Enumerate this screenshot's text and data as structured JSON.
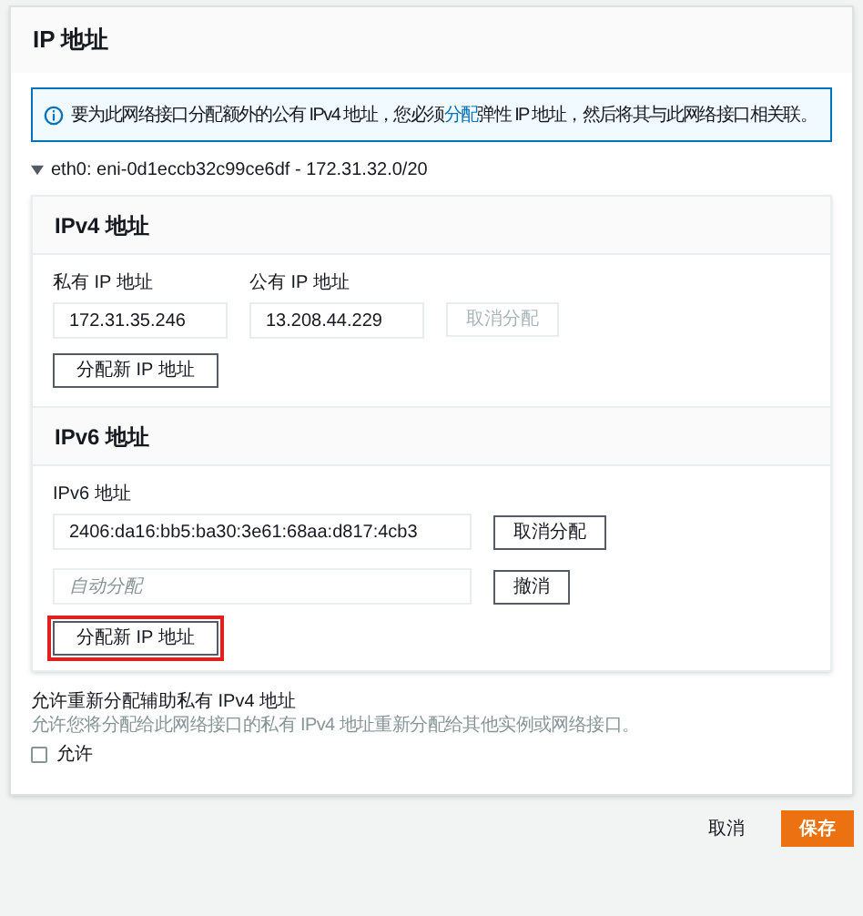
{
  "panel": {
    "title": "IP 地址"
  },
  "info": {
    "before": "要为此网络接口分配额外的公有 IPv4 地址，您必须",
    "link": "分配",
    "after": "弹性 IP 地址，然后将其与此网络接口相关联。"
  },
  "interface": {
    "label": "eth0: eni-0d1eccb32c99ce6df - 172.31.32.0/20",
    "expanded": true
  },
  "ipv4": {
    "title": "IPv4 地址",
    "private_label": "私有 IP 地址",
    "private_value": "172.31.35.246",
    "public_label": "公有 IP 地址",
    "public_value": "13.208.44.229",
    "unassign_button": {
      "label": "取消分配",
      "disabled": true
    },
    "assign_button": "分配新 IP 地址"
  },
  "ipv6": {
    "title": "IPv6 地址",
    "label": "IPv6 地址",
    "value": "2406:da16:bb5:ba30:3e61:68aa:d817:4cb3",
    "unassign_button": {
      "label": "取消分配",
      "disabled": false
    },
    "new_placeholder": "自动分配",
    "cancel_button": "撤消",
    "assign_button": {
      "label": "分配新 IP 地址",
      "highlighted": true
    }
  },
  "reassign": {
    "title": "允许重新分配辅助私有 IPv4 地址",
    "description": "允许您将分配给此网络接口的私有 IPv4 地址重新分配给其他实例或网络接口。",
    "checkbox": {
      "label": "允许",
      "checked": false
    }
  },
  "footer": {
    "cancel": "取消",
    "save": "保存"
  }
}
